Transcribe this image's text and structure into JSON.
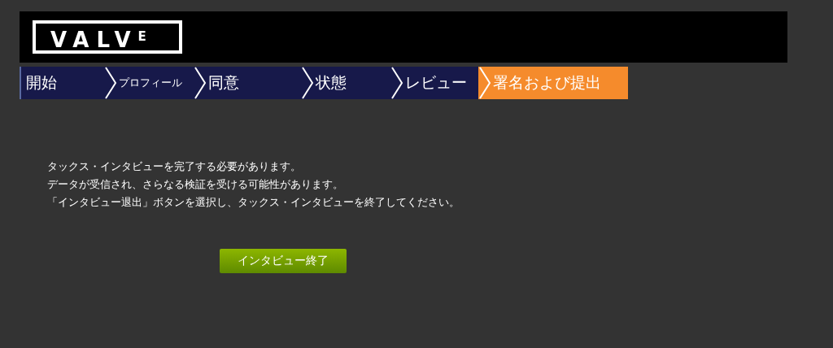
{
  "header": {
    "logo": "VALV$^{E}$"
  },
  "steps": [
    {
      "label": "開始",
      "selected": false
    },
    {
      "label": "プロフィール",
      "selected": false
    },
    {
      "label": "同意",
      "selected": false
    },
    {
      "label": "状態",
      "selected": false
    },
    {
      "label": "レビュー",
      "selected": false
    },
    {
      "label": "署名および提出",
      "selected": true
    }
  ],
  "message": [
    "タックス・インタビューを完了する必要があります。",
    "データが受信され、さらなる検証を受ける可能性があります。",
    "「インタビュー退出」ボタンを選択し、タックス・インタビューを終了してください。"
  ],
  "buttons": [
    {
      "label": "インタビュー終了"
    }
  ]
}
